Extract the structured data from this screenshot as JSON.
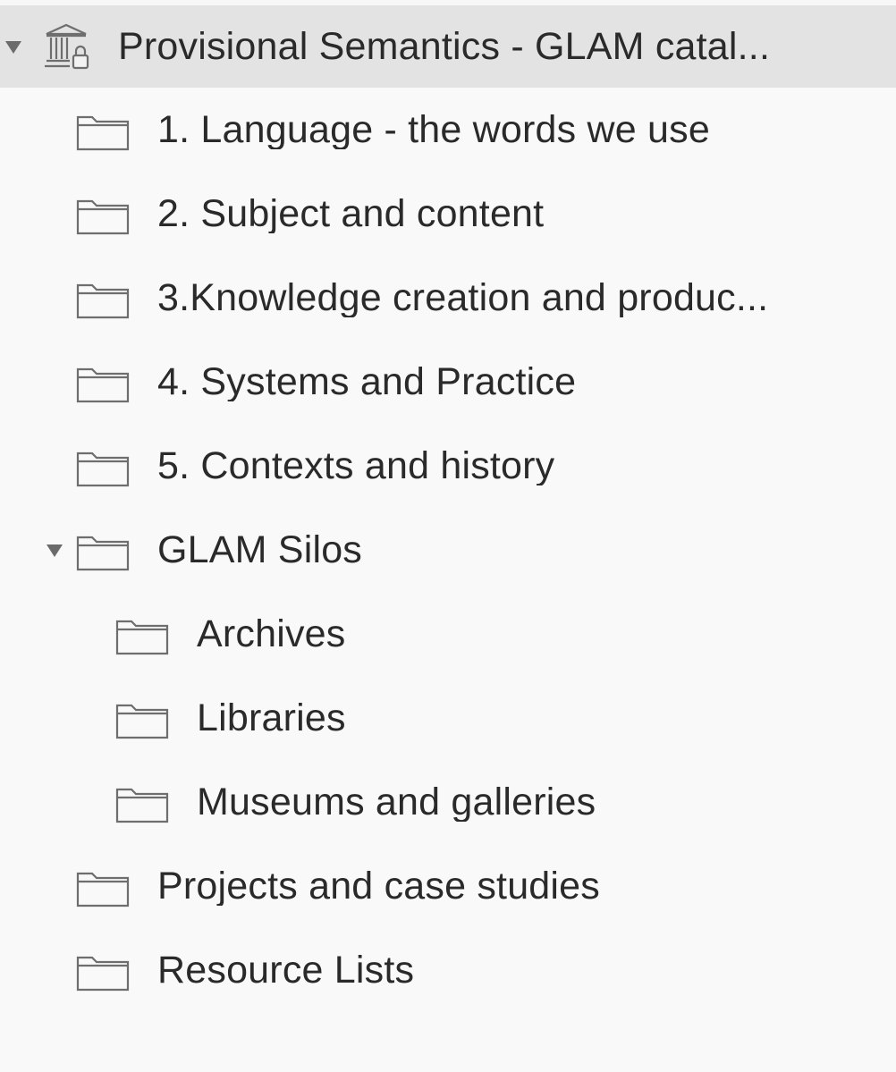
{
  "root": {
    "label": "Provisional Semantics - GLAM catal...",
    "icon": "library-locked-icon",
    "expanded": true
  },
  "folders": [
    {
      "label": "1. Language - the words we use",
      "icon": "folder-icon"
    },
    {
      "label": "2. Subject and content",
      "icon": "folder-icon"
    },
    {
      "label": "3.Knowledge creation and produc...",
      "icon": "folder-icon"
    },
    {
      "label": "4. Systems and Practice",
      "icon": "folder-icon"
    },
    {
      "label": "5. Contexts and history",
      "icon": "folder-icon"
    },
    {
      "label": "GLAM Silos",
      "icon": "folder-icon",
      "expanded": true,
      "children": [
        {
          "label": "Archives",
          "icon": "folder-icon"
        },
        {
          "label": "Libraries",
          "icon": "folder-icon"
        },
        {
          "label": "Museums and galleries",
          "icon": "folder-icon"
        }
      ]
    },
    {
      "label": "Projects and case studies",
      "icon": "folder-icon"
    },
    {
      "label": "Resource Lists",
      "icon": "folder-icon"
    }
  ],
  "colors": {
    "selected_row_bg": "#e3e3e3",
    "background": "#f9f9f9",
    "text": "#2a2a2a",
    "icon_stroke": "#6e6e6e"
  }
}
